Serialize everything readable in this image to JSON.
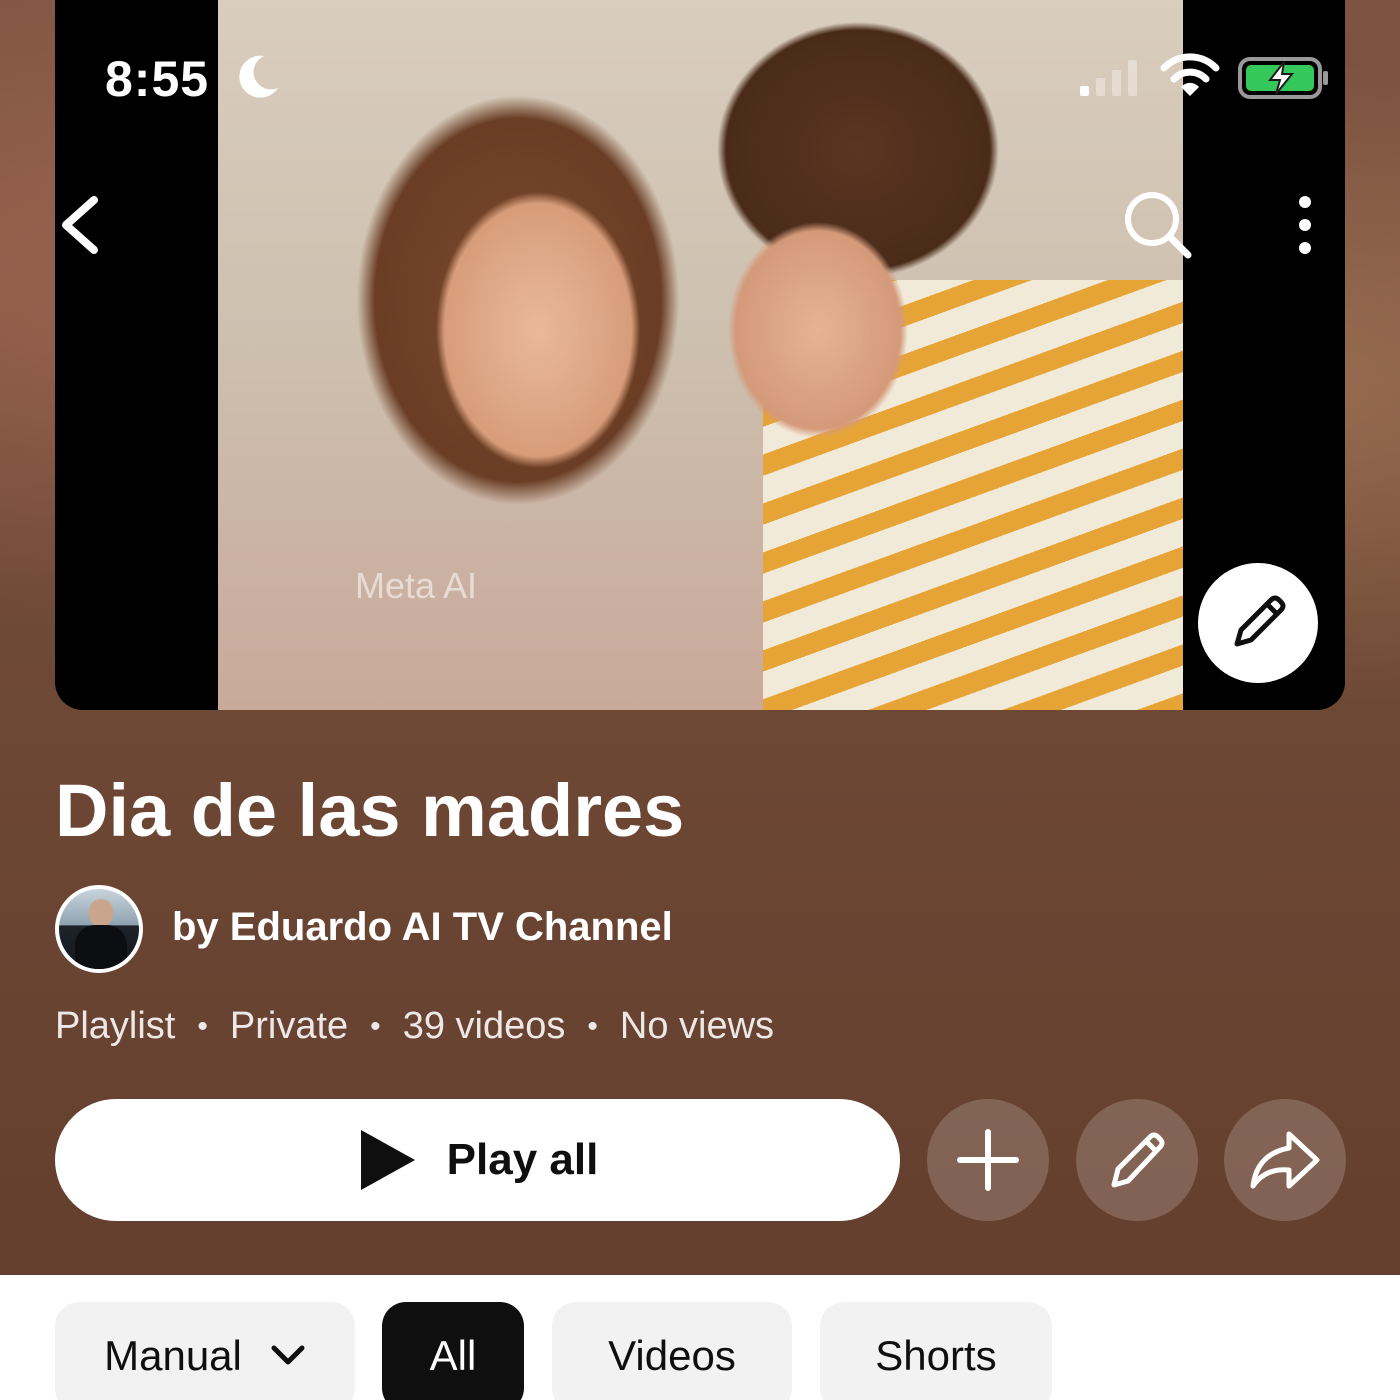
{
  "status_bar": {
    "time": "8:55",
    "icons": [
      "moon-icon",
      "cellular-signal-icon",
      "wifi-icon",
      "battery-charging-icon"
    ],
    "battery_color": "#34c759"
  },
  "top_nav": {
    "icons": [
      "back-icon",
      "search-icon",
      "more-vertical-icon"
    ]
  },
  "thumbnail": {
    "watermark": "Meta AI",
    "edit_icon": "pencil-icon"
  },
  "playlist": {
    "title": "Dia de las madres",
    "channel": "by Eduardo AI TV Channel",
    "meta": {
      "type": "Playlist",
      "visibility": "Private",
      "video_count": "39 videos",
      "views": "No views",
      "separator": "•"
    }
  },
  "actions": {
    "play_all": "Play all",
    "icons": [
      "play-icon",
      "add-icon",
      "pencil-icon",
      "share-icon"
    ]
  },
  "filters": {
    "sort_label": "Manual",
    "chips": [
      "All",
      "Videos",
      "Shorts"
    ],
    "selected": "All"
  },
  "colors": {
    "header_background": "#6f4a36",
    "chip_selected": "#0f0f0f",
    "chip_default": "#f2f2f2"
  }
}
